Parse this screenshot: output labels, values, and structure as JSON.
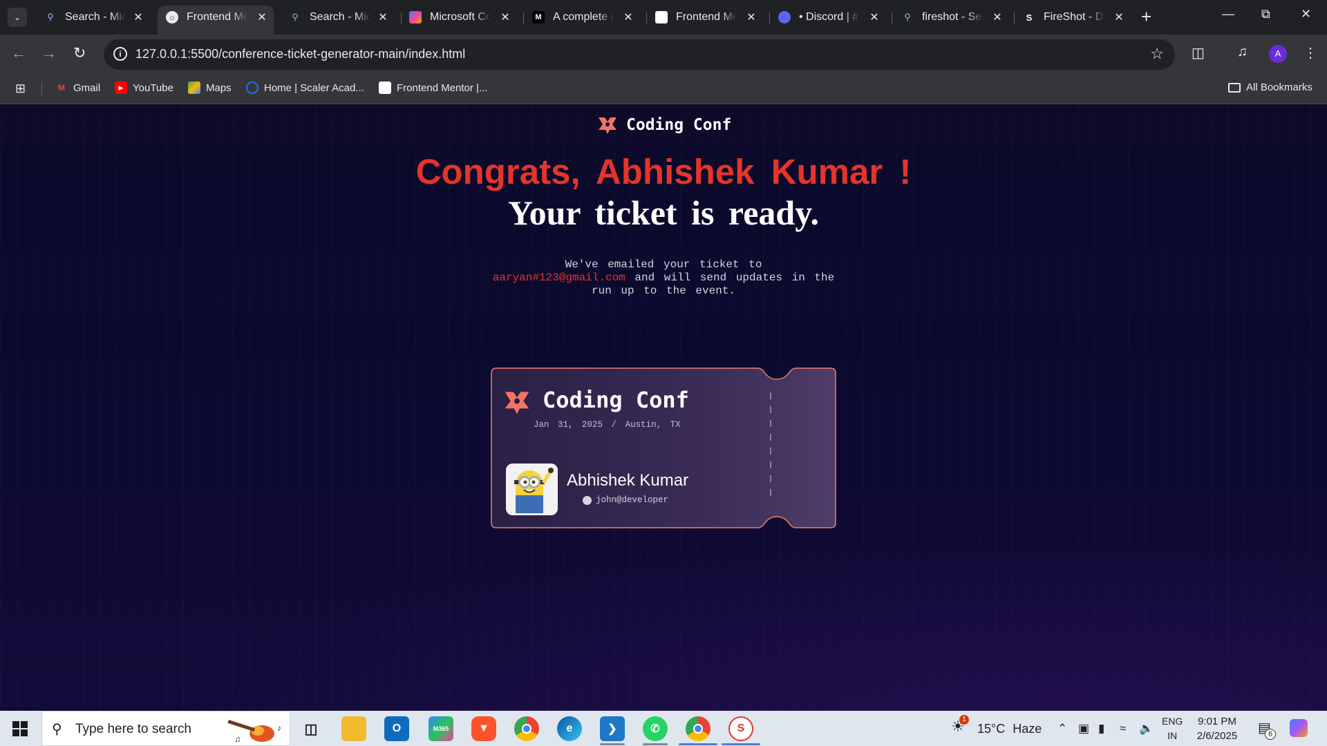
{
  "browser": {
    "tabs": [
      {
        "label": "Search - Microsoft Bing",
        "icon": "search-icon",
        "active": false
      },
      {
        "label": "Frontend Mentor",
        "icon": "frontend-mentor-icon",
        "active": true
      },
      {
        "label": "Search - Microsoft Bing",
        "icon": "search-icon",
        "active": false
      },
      {
        "label": "Microsoft Copilot",
        "icon": "copilot-icon",
        "active": false
      },
      {
        "label": "A complete guide",
        "icon": "medium-icon",
        "active": false
      },
      {
        "label": "Frontend Mentor",
        "icon": "frontend-mentor-icon",
        "active": false
      },
      {
        "label": "• Discord | #",
        "icon": "discord-icon",
        "active": false
      },
      {
        "label": "fireshot - Search",
        "icon": "search-icon",
        "active": false
      },
      {
        "label": "FireShot - Do",
        "icon": "fireshot-icon",
        "active": false
      }
    ],
    "url": "127.0.0.1:5500/conference-ticket-generator-main/index.html",
    "profile_initial": "A",
    "bookmarks": [
      {
        "label": "Gmail",
        "icon": "gmail-icon"
      },
      {
        "label": "YouTube",
        "icon": "youtube-icon"
      },
      {
        "label": "Maps",
        "icon": "maps-icon"
      },
      {
        "label": "Home | Scaler Acad...",
        "icon": "scaler-icon"
      },
      {
        "label": "Frontend Mentor |...",
        "icon": "frontend-mentor-icon"
      }
    ],
    "all_bookmarks": "All Bookmarks"
  },
  "page": {
    "brand": "Coding Conf",
    "headline": "Congrats, Abhishek Kumar !",
    "subheadline": "Your ticket is ready.",
    "message_pre": "We've emailed your ticket to",
    "email": "aaryan#123@gmail.com",
    "message_post": "and will send updates in the run up to the event.",
    "ticket": {
      "brand": "Coding Conf",
      "date": "Jan 31, 2025",
      "separator": "/",
      "location": "Austin, TX",
      "name": "Abhishek Kumar",
      "github": "john@developer"
    },
    "colors": {
      "accent": "#e5342a",
      "background": "#0c0825",
      "ticket_border": "#f07d6e"
    }
  },
  "taskbar": {
    "search_placeholder": "Type here to search",
    "weather_temp": "15°C",
    "weather_desc": "Haze",
    "weather_badge": "1",
    "lang_top": "ENG",
    "lang_bottom": "IN",
    "time": "9:01 PM",
    "date": "2/6/2025",
    "notification_count": "6"
  }
}
